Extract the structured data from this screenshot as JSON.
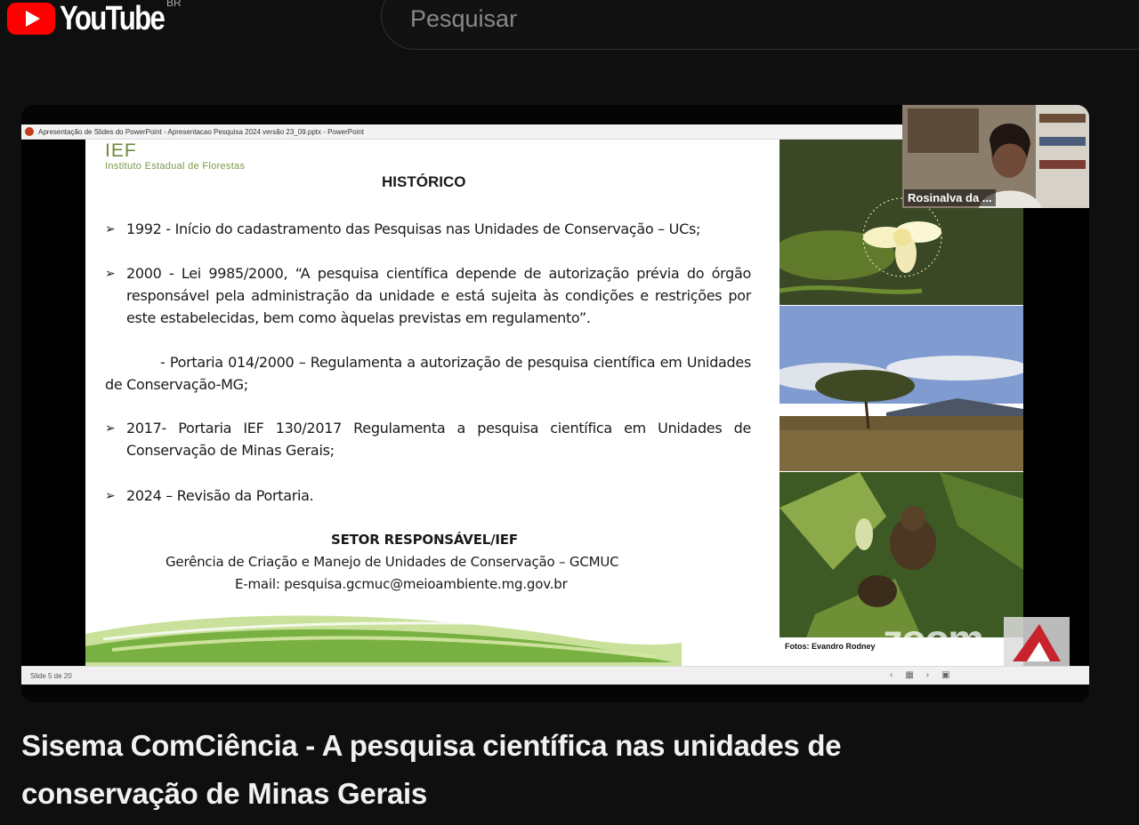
{
  "header": {
    "logo_text": "YouTube",
    "country_code": "BR",
    "search_placeholder": "Pesquisar"
  },
  "player": {
    "ppt_window_title": "Apresentação de Slides do PowerPoint  -  Apresentacao Pesquisa 2024 versão 23_09.pptx - PowerPoint",
    "status_slide_number": "Slide 5 de 20",
    "participant_name": "Rosinalva da ...",
    "zoom_watermark": "zoom",
    "slide": {
      "org_abbr": "IEF",
      "org_name": "Instituto Estadual de Florestas",
      "heading": "HISTÓRICO",
      "items": [
        "1992 - Início do cadastramento das Pesquisas nas Unidades de Conservação – UCs;",
        "2000 - Lei 9985/2000, “A pesquisa científica depende de autorização prévia do órgão responsável pela administração da unidade e está sujeita às condições e restrições por este estabelecidas, bem como àquelas previstas em regulamento”.",
        "- Portaria 014/2000 – Regulamenta a autorização de pesquisa científica em Unidades de Conservação-MG;",
        "2017- Portaria IEF 130/2017 Regulamenta a pesquisa científica em Unidades de Conservação de Minas Gerais;",
        "2024 – Revisão da Portaria."
      ],
      "sector_title": "SETOR RESPONSÁVEL/IEF",
      "sector_name": "Gerência de Criação e Manejo de Unidades de Conservação – GCMUC",
      "sector_email": "E-mail:  pesquisa.gcmuc@meioambiente.mg.gov.br",
      "photo_credit": "Fotos: Evandro Rodney"
    }
  },
  "video": {
    "title": "Sisema ComCiência - A pesquisa científica nas unidades de conservação de Minas Gerais"
  },
  "colors": {
    "page_bg": "#0f0f0f",
    "youtube_red": "#ff0000",
    "ief_green": "#6c8a3e"
  }
}
